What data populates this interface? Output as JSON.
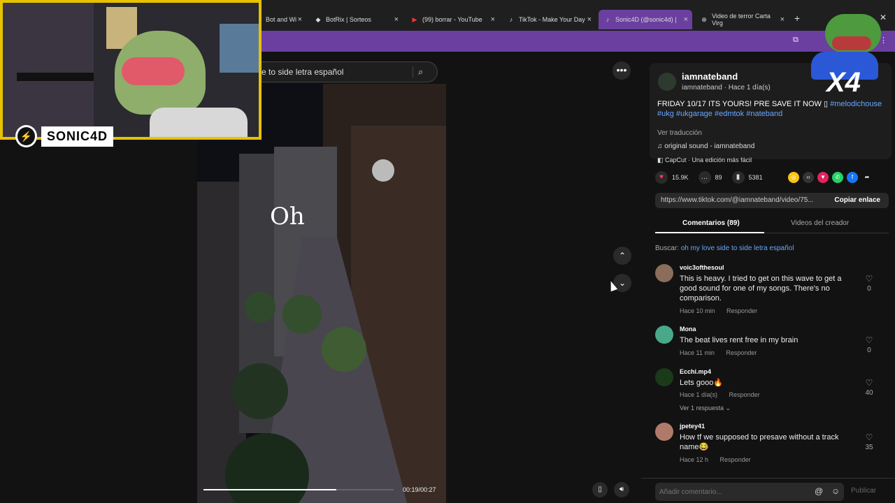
{
  "browser": {
    "tabs": [
      {
        "label": "Bot and Wi",
        "favicon": "·"
      },
      {
        "label": "BotRix | Sorteos",
        "favicon": "◆"
      },
      {
        "label": "(99) borrar - YouTube",
        "favicon": "▶"
      },
      {
        "label": "TikTok - Make Your Day",
        "favicon": "♪"
      },
      {
        "label": "Sonic4D (@sonic4d) |",
        "favicon": "♪"
      },
      {
        "label": "Video de terror Carta Virg",
        "favicon": "⊕"
      }
    ],
    "colors": {
      "accent": "#6b3fa0",
      "bg": "#121212"
    }
  },
  "overlay": {
    "streamer_name": "SONIC4D",
    "badge_text": "X4"
  },
  "search": {
    "value": "e to side letra español"
  },
  "video": {
    "overlay_text": "Oh",
    "timecode": "00:19/00:27",
    "progress": 0.7
  },
  "post": {
    "author": "iamnateband",
    "author_sub": "iamnateband · Hace 1 día(s)",
    "desc_text": "FRIDAY 10/17 ITS YOURS! PRE SAVE IT NOW ▯ ",
    "tags": [
      "#melodichouse",
      "#ukg",
      "#ukgarage",
      "#edmtok",
      "#nateband"
    ],
    "translate": "Ver traducción",
    "sound": "original sound - iamnateband",
    "capcut": "CapCut · Una edición más fácil",
    "likes": "15.9K",
    "comments_count": "89",
    "saves": "5381",
    "url": "https://www.tiktok.com/@iamnateband/video/75...",
    "copy_label": "Copiar enlace"
  },
  "tabs": {
    "comments": "Comentarios (89)",
    "creator": "Videos del creador"
  },
  "search_hint": {
    "prefix": "Buscar: ",
    "query": "oh my love side to side letra español"
  },
  "comments": [
    {
      "user": "voic3ofthesoul",
      "text": "This is heavy. I tried to get on this wave to get a good sound for one of my songs. There's no comparison.",
      "time": "Hace 10 min",
      "reply": "Responder",
      "likes": "0",
      "avatar_color": "#8a6d5a"
    },
    {
      "user": "Mona",
      "text": "The beat lives rent free in my brain",
      "time": "Hace 11 min",
      "reply": "Responder",
      "likes": "0",
      "avatar_color": "#4aa88a"
    },
    {
      "user": "Ecchi.mp4",
      "text": "Lets gooo🔥",
      "time": "Hace 1 día(s)",
      "reply": "Responder",
      "likes": "40",
      "replies": "Ver 1 respuesta ⌄",
      "avatar_color": "#1a3a1a"
    },
    {
      "user": "jpetey41",
      "text": "How tf we supposed to presave without a track name😂",
      "time": "Hace 12 h",
      "reply": "Responder",
      "likes": "35",
      "avatar_color": "#b07a6a"
    }
  ],
  "compose": {
    "placeholder": "Añadir comentario...",
    "post_label": "Publicar"
  }
}
